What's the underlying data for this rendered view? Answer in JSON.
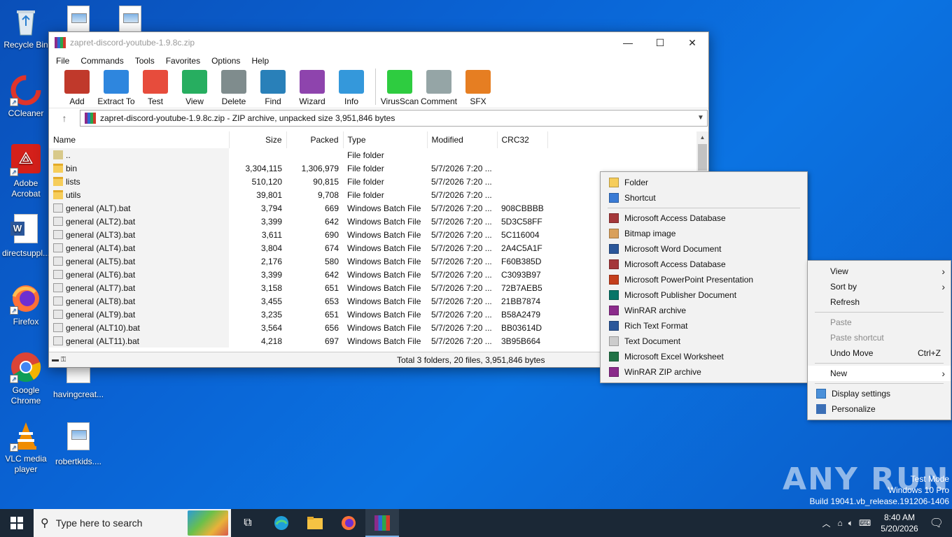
{
  "desktop": {
    "icons": [
      {
        "label": "Recycle Bin"
      },
      {
        "label": "CCleaner"
      },
      {
        "label": "Adobe Acrobat"
      },
      {
        "label": "directsuppl..."
      },
      {
        "label": "Firefox"
      },
      {
        "label": "Google Chrome"
      },
      {
        "label": "havingcreat..."
      },
      {
        "label": "VLC media player"
      },
      {
        "label": "robertkids...."
      }
    ]
  },
  "window": {
    "title": "zapret-discord-youtube-1.9.8c.zip",
    "controls": {
      "minimize": "—",
      "maximize": "☐",
      "close": "✕"
    },
    "menu": [
      "File",
      "Commands",
      "Tools",
      "Favorites",
      "Options",
      "Help"
    ],
    "toolbar": [
      {
        "label": "Add",
        "color": "#c0392b"
      },
      {
        "label": "Extract To",
        "color": "#2e86de"
      },
      {
        "label": "Test",
        "color": "#e74c3c"
      },
      {
        "label": "View",
        "color": "#27ae60"
      },
      {
        "label": "Delete",
        "color": "#7f8c8d"
      },
      {
        "label": "Find",
        "color": "#2980b9"
      },
      {
        "label": "Wizard",
        "color": "#8e44ad"
      },
      {
        "label": "Info",
        "color": "#3498db"
      },
      {
        "label": "VirusScan",
        "color": "#2ecc40"
      },
      {
        "label": "Comment",
        "color": "#95a5a6"
      },
      {
        "label": "SFX",
        "color": "#e67e22"
      }
    ],
    "address": "zapret-discord-youtube-1.9.8c.zip - ZIP archive, unpacked size 3,951,846 bytes",
    "columns": {
      "name": "Name",
      "size": "Size",
      "packed": "Packed",
      "type": "Type",
      "modified": "Modified",
      "crc": "CRC32"
    },
    "files": [
      {
        "name": "..",
        "size": "",
        "packed": "",
        "type": "File folder",
        "modified": "",
        "crc": "",
        "kind": "up"
      },
      {
        "name": "bin",
        "size": "3,304,115",
        "packed": "1,306,979",
        "type": "File folder",
        "modified": "5/7/2026 7:20 ...",
        "crc": "",
        "kind": "folder"
      },
      {
        "name": "lists",
        "size": "510,120",
        "packed": "90,815",
        "type": "File folder",
        "modified": "5/7/2026 7:20 ...",
        "crc": "",
        "kind": "folder"
      },
      {
        "name": "utils",
        "size": "39,801",
        "packed": "9,708",
        "type": "File folder",
        "modified": "5/7/2026 7:20 ...",
        "crc": "",
        "kind": "folder"
      },
      {
        "name": "general (ALT).bat",
        "size": "3,794",
        "packed": "669",
        "type": "Windows Batch File",
        "modified": "5/7/2026 7:20 ...",
        "crc": "908CBBBB",
        "kind": "bat"
      },
      {
        "name": "general (ALT2).bat",
        "size": "3,399",
        "packed": "642",
        "type": "Windows Batch File",
        "modified": "5/7/2026 7:20 ...",
        "crc": "5D3C58FF",
        "kind": "bat"
      },
      {
        "name": "general (ALT3).bat",
        "size": "3,611",
        "packed": "690",
        "type": "Windows Batch File",
        "modified": "5/7/2026 7:20 ...",
        "crc": "5C116004",
        "kind": "bat"
      },
      {
        "name": "general (ALT4).bat",
        "size": "3,804",
        "packed": "674",
        "type": "Windows Batch File",
        "modified": "5/7/2026 7:20 ...",
        "crc": "2A4C5A1F",
        "kind": "bat"
      },
      {
        "name": "general (ALT5).bat",
        "size": "2,176",
        "packed": "580",
        "type": "Windows Batch File",
        "modified": "5/7/2026 7:20 ...",
        "crc": "F60B385D",
        "kind": "bat"
      },
      {
        "name": "general (ALT6).bat",
        "size": "3,399",
        "packed": "642",
        "type": "Windows Batch File",
        "modified": "5/7/2026 7:20 ...",
        "crc": "C3093B97",
        "kind": "bat"
      },
      {
        "name": "general (ALT7).bat",
        "size": "3,158",
        "packed": "651",
        "type": "Windows Batch File",
        "modified": "5/7/2026 7:20 ...",
        "crc": "72B7AEB5",
        "kind": "bat"
      },
      {
        "name": "general (ALT8).bat",
        "size": "3,455",
        "packed": "653",
        "type": "Windows Batch File",
        "modified": "5/7/2026 7:20 ...",
        "crc": "21BB7874",
        "kind": "bat"
      },
      {
        "name": "general (ALT9).bat",
        "size": "3,235",
        "packed": "651",
        "type": "Windows Batch File",
        "modified": "5/7/2026 7:20 ...",
        "crc": "B58A2479",
        "kind": "bat"
      },
      {
        "name": "general (ALT10).bat",
        "size": "3,564",
        "packed": "656",
        "type": "Windows Batch File",
        "modified": "5/7/2026 7:20 ...",
        "crc": "BB03614D",
        "kind": "bat"
      },
      {
        "name": "general (ALT11).bat",
        "size": "4,218",
        "packed": "697",
        "type": "Windows Batch File",
        "modified": "5/7/2026 7:20 ...",
        "crc": "3B95B664",
        "kind": "bat"
      }
    ],
    "status_total": "Total 3 folders, 20 files, 3,951,846 bytes"
  },
  "new_menu": {
    "items": [
      {
        "label": "Folder",
        "icon": "folder-icon",
        "color": "#f6cd5a"
      },
      {
        "label": "Shortcut",
        "icon": "shortcut-icon",
        "color": "#3a7bd5"
      },
      {
        "sep": true
      },
      {
        "label": "Microsoft Access Database",
        "icon": "access-icon",
        "color": "#a4373a"
      },
      {
        "label": "Bitmap image",
        "icon": "bitmap-icon",
        "color": "#d9a05b"
      },
      {
        "label": "Microsoft Word Document",
        "icon": "word-icon",
        "color": "#2b579a"
      },
      {
        "label": "Microsoft Access Database",
        "icon": "access-icon",
        "color": "#a4373a"
      },
      {
        "label": "Microsoft PowerPoint Presentation",
        "icon": "powerpoint-icon",
        "color": "#c43e1c"
      },
      {
        "label": "Microsoft Publisher Document",
        "icon": "publisher-icon",
        "color": "#077568"
      },
      {
        "label": "WinRAR archive",
        "icon": "winrar-icon",
        "color": "#8b2b8b"
      },
      {
        "label": "Rich Text Format",
        "icon": "rtf-icon",
        "color": "#2b579a"
      },
      {
        "label": "Text Document",
        "icon": "text-icon",
        "color": "#cccccc"
      },
      {
        "label": "Microsoft Excel Worksheet",
        "icon": "excel-icon",
        "color": "#217346"
      },
      {
        "label": "WinRAR ZIP archive",
        "icon": "winrar-zip-icon",
        "color": "#8b2b8b"
      }
    ]
  },
  "desktop_menu": {
    "view": "View",
    "sort_by": "Sort by",
    "refresh": "Refresh",
    "paste": "Paste",
    "paste_shortcut": "Paste shortcut",
    "undo_move": "Undo Move",
    "undo_shortcut": "Ctrl+Z",
    "new": "New",
    "display_settings": "Display settings",
    "personalize": "Personalize"
  },
  "taskbar": {
    "search_placeholder": "Type here to search",
    "time": "8:40 AM",
    "date": "5/20/2026"
  },
  "watermark": {
    "brand": "ANY RUN",
    "line1": "Test Mode",
    "line2": "Windows 10 Pro",
    "line3": "Build 19041.vb_release.191206-1406"
  }
}
